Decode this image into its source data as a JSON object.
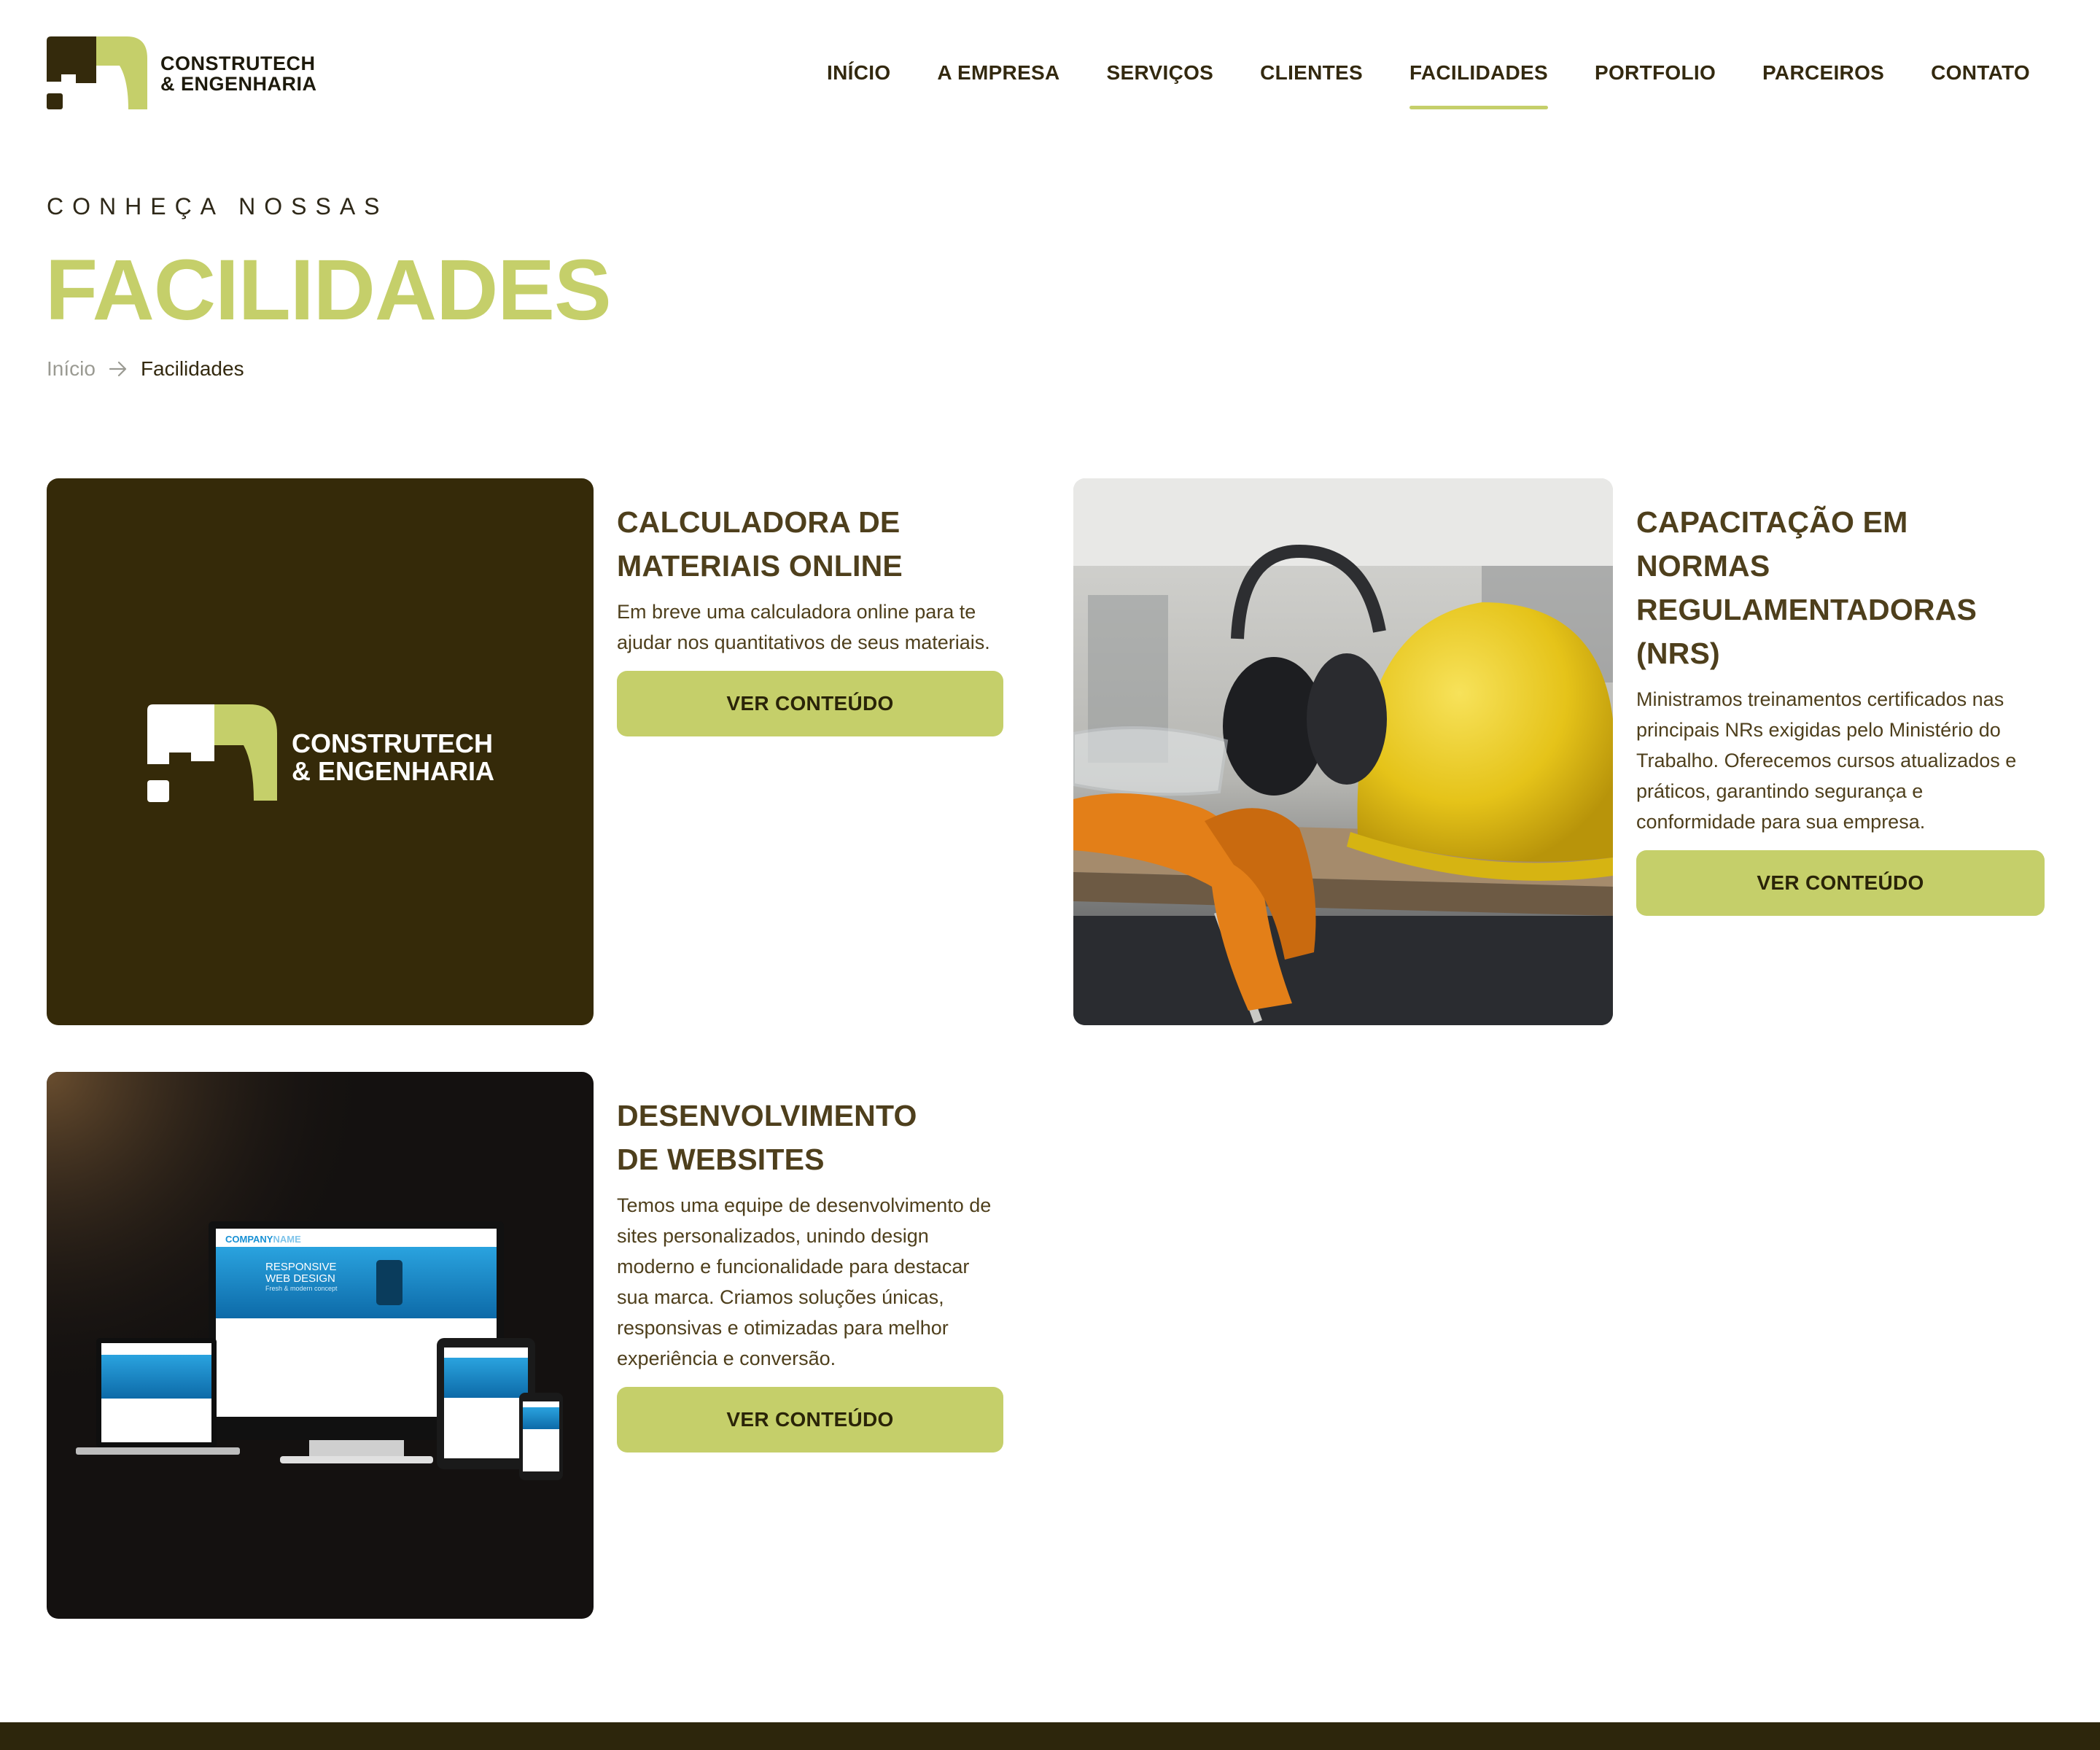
{
  "brand": {
    "name_line1": "CONSTRUTECH",
    "name_line2": "& ENGENHARIA",
    "colors": {
      "accent": "#c5cf6a",
      "dark": "#33290f",
      "logo_dark": "#342a0c"
    }
  },
  "nav": {
    "items": [
      {
        "label": "INÍCIO",
        "active": false
      },
      {
        "label": "A EMPRESA",
        "active": false
      },
      {
        "label": "SERVIÇOS",
        "active": false
      },
      {
        "label": "CLIENTES",
        "active": false
      },
      {
        "label": "FACILIDADES",
        "active": true
      },
      {
        "label": "PORTFOLIO",
        "active": false
      },
      {
        "label": "PARCEIROS",
        "active": false
      },
      {
        "label": "CONTATO",
        "active": false
      }
    ]
  },
  "hero": {
    "kicker": "CONHEÇA NOSSAS",
    "title": "FACILIDADES"
  },
  "breadcrumb": {
    "home": "Início",
    "separator_icon": "arrow-right-icon",
    "current": "Facilidades"
  },
  "cards": [
    {
      "title_line1": "CALCULADORA DE",
      "title_line2": "MATERIAIS ONLINE",
      "text": "Em breve uma calculadora online para te ajudar nos quantitativos de seus materiais.",
      "button": "VER CONTEÚDO",
      "image": "company-logo-image"
    },
    {
      "title_line1": "CAPACITAÇÃO EM NORMAS",
      "title_line2": "REGULAMENTADORAS (NRS)",
      "text": "Ministramos treinamentos certificados nas principais NRs exigidas pelo Ministério do Trabalho. Oferecemos cursos atualizados e práticos, garantindo segurança e conformidade para sua empresa.",
      "button": "VER CONTEÚDO",
      "image": "safety-equipment-photo"
    },
    {
      "title_line1": "DESENVOLVIMENTO",
      "title_line2": "DE WEBSITES",
      "text": "Temos uma equipe de desenvolvimento de sites personalizados, unindo design moderno e funcionalidade para destacar sua marca. Criamos soluções únicas, responsivas e otimizadas para melhor experiência e conversão.",
      "button": "VER CONTEÚDO",
      "image": "responsive-devices-photo",
      "mockup": {
        "company": "COMPANY",
        "company_suffix": "NAME",
        "headline1": "RESPONSIVE",
        "headline2": "WEB DESIGN",
        "tagline": "Fresh & modern concept"
      }
    }
  ]
}
